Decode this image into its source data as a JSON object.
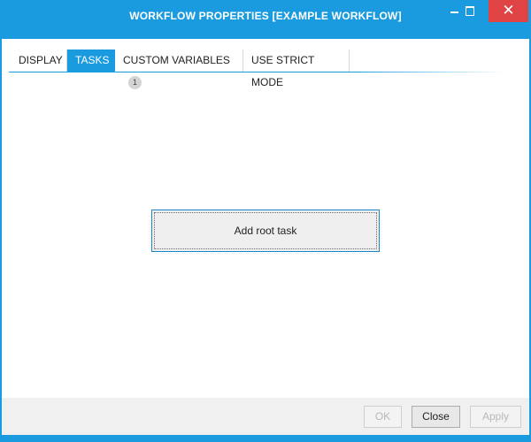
{
  "window": {
    "title": "WORKFLOW PROPERTIES [EXAMPLE WORKFLOW]",
    "minimize_glyph": "—",
    "close_glyph": "✕",
    "accent_color": "#1a9be0",
    "close_color": "#e04343"
  },
  "tabs": [
    {
      "label": "DISPLAY",
      "active": false
    },
    {
      "label": "TASKS",
      "active": true
    },
    {
      "label": "CUSTOM VARIABLES",
      "badge": "1",
      "active": false
    },
    {
      "label": "USE STRICT MODE",
      "active": false
    }
  ],
  "tasks_panel": {
    "add_root_task_label": "Add root task"
  },
  "footer": {
    "ok_label": "OK",
    "close_label": "Close",
    "apply_label": "Apply"
  },
  "icons": [
    "minimize-icon",
    "maximize-icon",
    "close-icon"
  ]
}
